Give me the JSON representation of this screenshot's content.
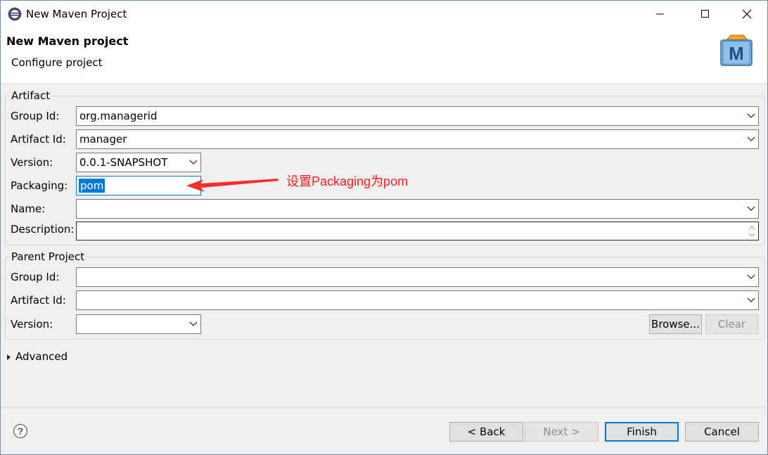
{
  "window": {
    "title": "New Maven Project"
  },
  "header": {
    "title": "New Maven project",
    "subtitle": "Configure project",
    "logo_letter": "M"
  },
  "artifact": {
    "group_label": "Artifact",
    "group_id_label": "Group Id:",
    "group_id_value": "org.managerid",
    "artifact_id_label": "Artifact Id:",
    "artifact_id_value": "manager",
    "version_label": "Version:",
    "version_value": "0.0.1-SNAPSHOT",
    "packaging_label": "Packaging:",
    "packaging_value": "pom",
    "name_label": "Name:",
    "name_value": "",
    "description_label": "Description:",
    "description_value": ""
  },
  "annotation": {
    "text": "设置Packaging为pom",
    "color": "#ff1a1a"
  },
  "parent": {
    "group_label": "Parent Project",
    "group_id_label": "Group Id:",
    "group_id_value": "",
    "artifact_id_label": "Artifact Id:",
    "artifact_id_value": "",
    "version_label": "Version:",
    "version_value": "",
    "browse_label": "Browse...",
    "clear_label": "Clear"
  },
  "advanced": {
    "label": "Advanced"
  },
  "footer": {
    "help_icon": "help-icon",
    "back_label": "< Back",
    "next_label": "Next >",
    "finish_label": "Finish",
    "cancel_label": "Cancel"
  },
  "colors": {
    "accent": "#0078d7",
    "window_bg": "#f0f0f0"
  }
}
